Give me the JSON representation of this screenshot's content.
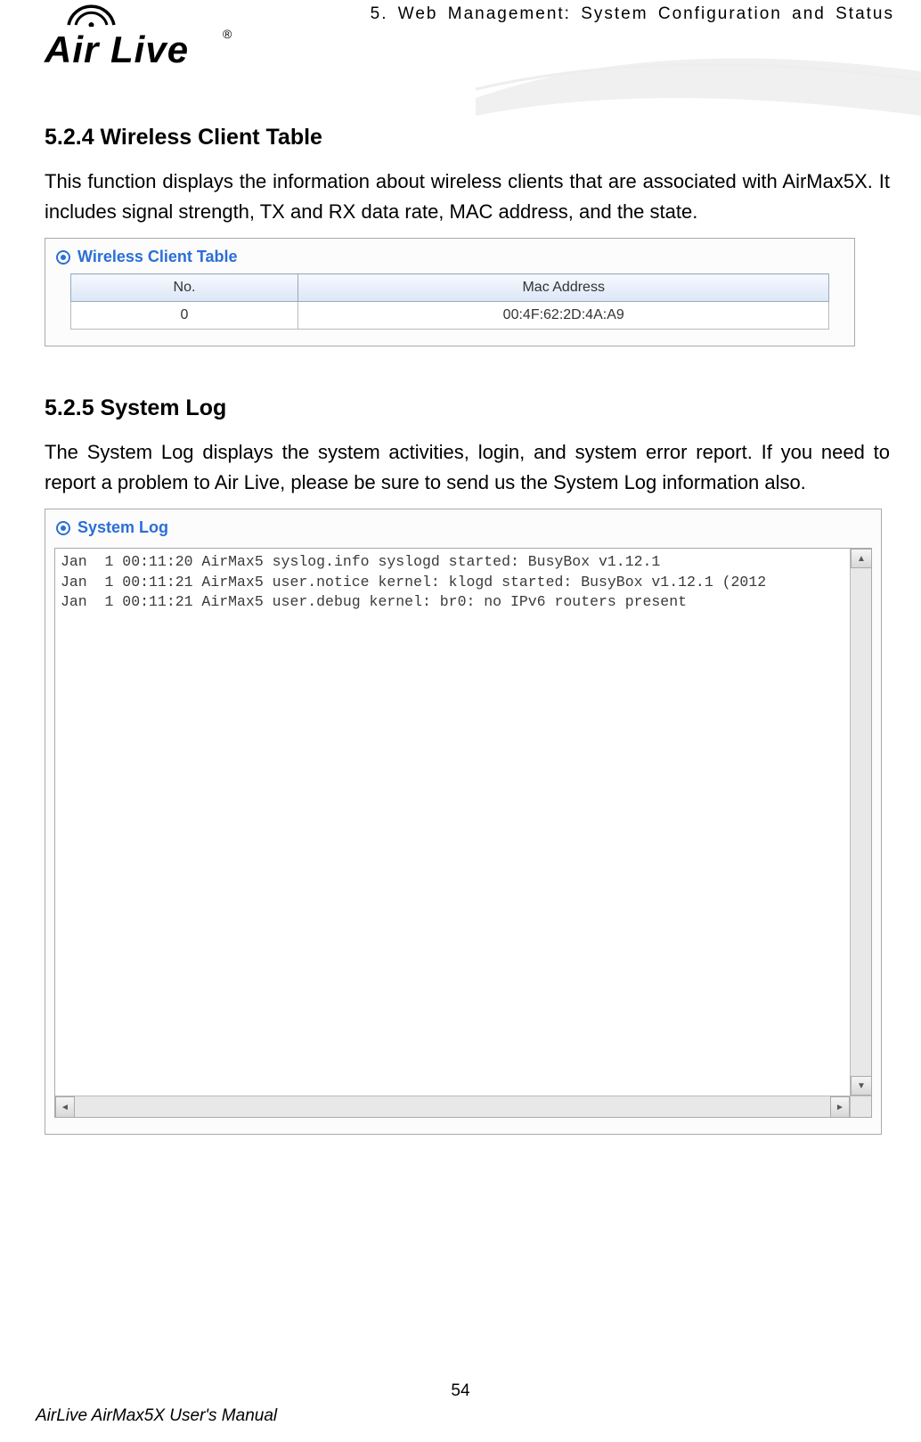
{
  "header": {
    "chapter_line": "5.  Web  Management:  System  Configuration  and  Status",
    "logo_text": "Air Live",
    "logo_reg": "®"
  },
  "section_wct": {
    "heading": "5.2.4 Wireless Client Table",
    "para": "This function displays the information about wireless clients that are associated with AirMax5X. It includes signal strength, TX and RX data rate, MAC address, and the state.",
    "panel_title": "Wireless Client Table",
    "table": {
      "headers": [
        "No.",
        "Mac Address"
      ],
      "row": [
        "0",
        "00:4F:62:2D:4A:A9"
      ]
    }
  },
  "section_log": {
    "heading": "5.2.5 System Log",
    "para": "The System Log displays the system activities, login, and system error report. If you need to report a problem to Air Live, please be sure to send us the System Log information also.",
    "panel_title": "System Log",
    "log_lines": "Jan  1 00:11:20 AirMax5 syslog.info syslogd started: BusyBox v1.12.1\nJan  1 00:11:21 AirMax5 user.notice kernel: klogd started: BusyBox v1.12.1 (2012\nJan  1 00:11:21 AirMax5 user.debug kernel: br0: no IPv6 routers present"
  },
  "footer": {
    "page_number": "54",
    "manual_title": "AirLive AirMax5X User's Manual"
  }
}
